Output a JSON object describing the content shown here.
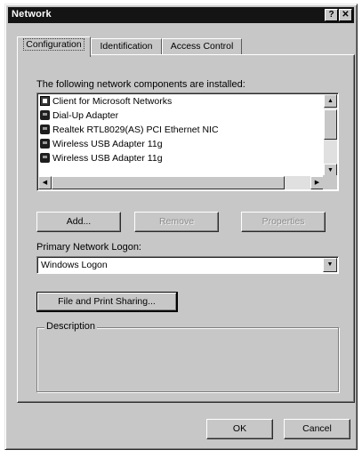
{
  "window": {
    "title": "Network",
    "help_button": "?",
    "close_button": "✕"
  },
  "tabs": [
    {
      "label": "Configuration",
      "active": true
    },
    {
      "label": "Identification",
      "active": false
    },
    {
      "label": "Access Control",
      "active": false
    }
  ],
  "components": {
    "label": "The following network components are installed:",
    "items": [
      {
        "label": "Client for Microsoft Networks",
        "icon": "client-icon"
      },
      {
        "label": "Dial-Up Adapter",
        "icon": "network-adapter-icon"
      },
      {
        "label": "Realtek RTL8029(AS) PCI Ethernet NIC",
        "icon": "network-adapter-icon"
      },
      {
        "label": "Wireless USB Adapter 11g",
        "icon": "network-adapter-icon"
      },
      {
        "label": "Wireless USB Adapter 11g",
        "icon": "network-adapter-icon"
      }
    ]
  },
  "buttons": {
    "add": "Add...",
    "remove": "Remove",
    "properties": "Properties",
    "file_print_sharing": "File and Print Sharing...",
    "ok": "OK",
    "cancel": "Cancel"
  },
  "logon": {
    "label": "Primary Network Logon:",
    "value": "Windows Logon"
  },
  "description": {
    "label": "Description"
  }
}
